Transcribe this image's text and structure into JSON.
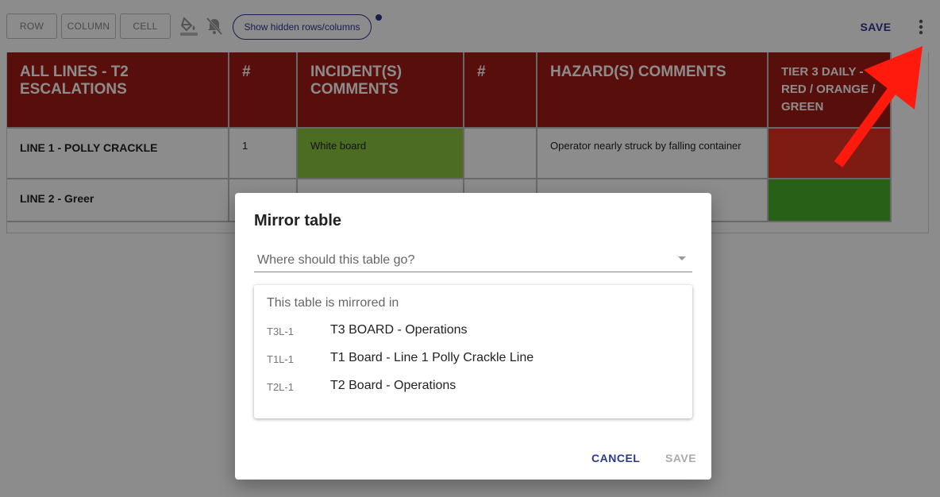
{
  "toolbar": {
    "row_label": "ROW",
    "column_label": "COLUMN",
    "cell_label": "CELL",
    "fill_icon": "paint-bucket-icon",
    "notifications_off_icon": "notifications-off-icon",
    "show_hidden_label": "Show hidden rows/columns",
    "save_label": "SAVE",
    "menu_icon": "more-vert-icon"
  },
  "table": {
    "headers": [
      "ALL LINES - T2 ESCALATIONS",
      "#",
      "INCIDENT(S) COMMENTS",
      "#",
      "HAZARD(S) COMMENTS",
      "TIER 3 DAILY - RED / ORANGE / GREEN"
    ],
    "rows": [
      {
        "label": "LINE 1 - POLLY CRACKLE",
        "num1": "1",
        "incident": "White board",
        "num2": "",
        "hazard": "Operator nearly struck by falling container",
        "status_color": "#e53324"
      },
      {
        "label": "LINE 2 - Greer",
        "num1": "",
        "incident": "",
        "num2": "",
        "hazard": "",
        "status_color": "#4caf2a"
      }
    ],
    "header_color": "#a01c14",
    "incident_highlight_color": "#8bc53f"
  },
  "dialog": {
    "title": "Mirror table",
    "select_placeholder": "Where should this table go?",
    "mirrored_heading": "This table is mirrored in",
    "mirrors": [
      {
        "code": "T3L-1",
        "name": "T3 BOARD - Operations"
      },
      {
        "code": "T1L-1",
        "name": "T1 Board - Line 1 Polly Crackle Line"
      },
      {
        "code": "T2L-1",
        "name": "T2 Board - Operations"
      }
    ],
    "cancel_label": "CANCEL",
    "save_label": "SAVE"
  },
  "accent_color": "#2b3990",
  "annotation_arrow_color": "#ff1a0d"
}
